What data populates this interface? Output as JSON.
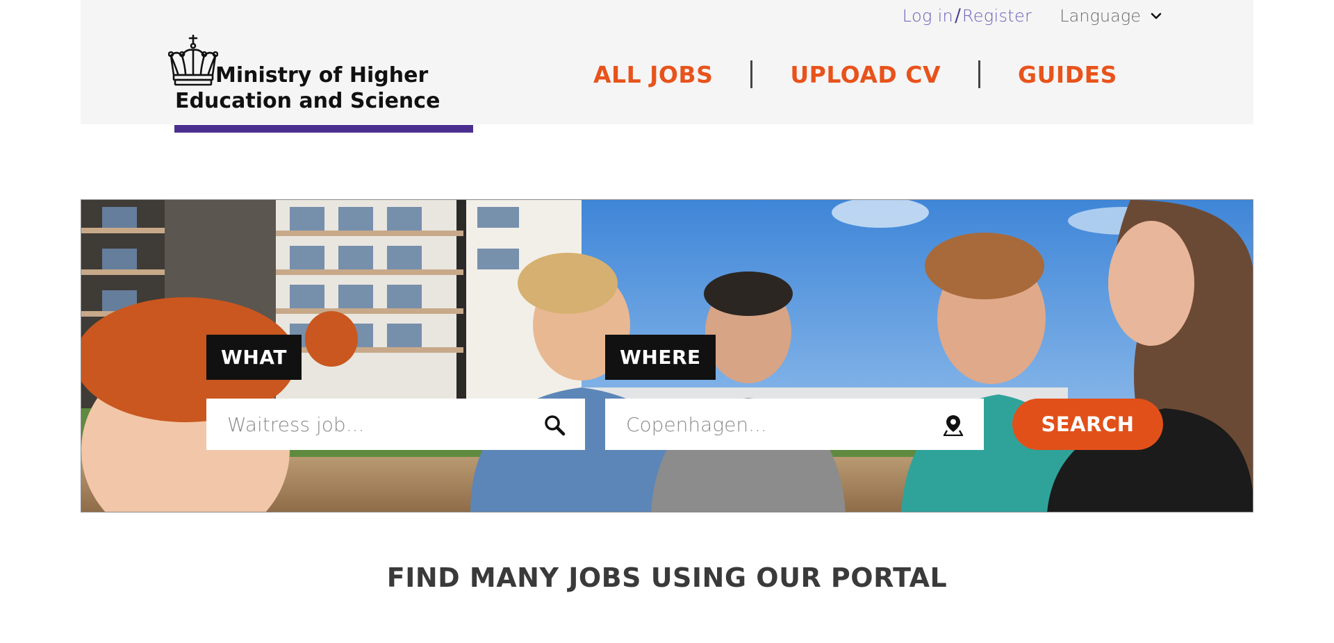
{
  "header": {
    "login_label": "Log in",
    "login_separator": "/",
    "register_label": "Register",
    "language_label": "Language",
    "logo": {
      "icon": "crown-icon",
      "line1": "Ministry of Higher",
      "line2": "Education and Science"
    },
    "nav": [
      {
        "label": "ALL JOBS"
      },
      {
        "label": "UPLOAD CV"
      },
      {
        "label": "GUIDES"
      }
    ]
  },
  "hero": {
    "image": "photo of students talking outdoors in front of apartment buildings",
    "what": {
      "label": "WHAT",
      "placeholder": "Waitress job...",
      "icon": "search-icon"
    },
    "where": {
      "label": "WHERE",
      "placeholder": "Copenhagen...",
      "icon": "location-pin-icon"
    },
    "search_label": "SEARCH"
  },
  "tagline": "FIND MANY JOBS USING OUR PORTAL",
  "colors": {
    "accent_orange": "#e8531b",
    "brand_purple": "#4a2f8f",
    "link_purple": "#6b5fb8",
    "header_bg": "#f5f5f5"
  }
}
